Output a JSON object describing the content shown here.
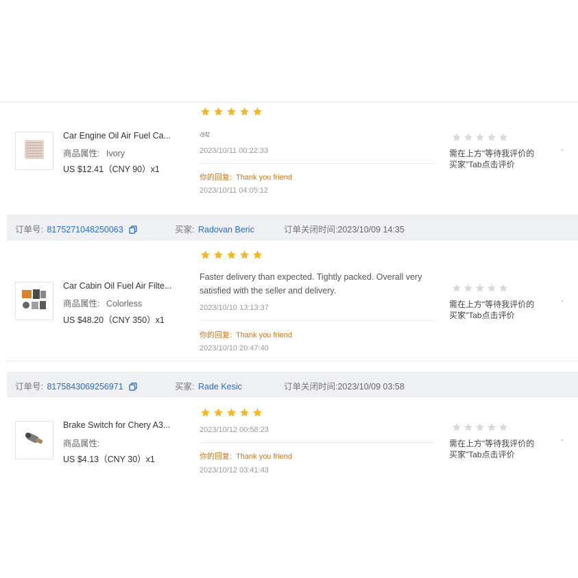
{
  "labels": {
    "order_no": "订单号:",
    "buyer": "买家:",
    "close_time": "订单关闭时间:",
    "your_reply": "你的回复:",
    "wait_line1": "需在上方\"等待我评价的",
    "wait_line2": "买家\"Tab点击评价",
    "more": "·"
  },
  "colors": {
    "star": "#f5b524",
    "star_empty": "#d9d9d9",
    "link": "#2b6cc8",
    "reply": "#c8761e"
  },
  "orders": [
    {
      "header": null,
      "product": {
        "title": "Car Engine Oil Air Fuel Ca...",
        "attr_label": "商品属性:",
        "attr_value": "Ivory",
        "price": "US $12.41（CNY 90）x1",
        "thumb_icon": "air-filter-icon"
      },
      "review": {
        "rating": 5,
        "text": "ওয়",
        "time": "2023/10/11 00:22:33",
        "reply_text": "Thank you friend",
        "reply_time": "2023/10/11 04:05:12"
      },
      "seller_rating": 0
    },
    {
      "header": {
        "order_no": "8175271048250063",
        "buyer": "Radovan Beric",
        "close_time": "2023/10/09 14:35"
      },
      "product": {
        "title": "Car Cabin Oil Fuel Air Filte...",
        "attr_label": "商品属性:",
        "attr_value": "Colorless",
        "price": "US $48.20（CNY 350）x1",
        "thumb_icon": "filter-kit-icon"
      },
      "review": {
        "rating": 5,
        "text": "Faster delivery than expected. Tightly packed. Overall very satisfied with the seller and delivery.",
        "time": "2023/10/10 13:13:37",
        "reply_text": "Thank you friend",
        "reply_time": "2023/10/10 20:47:40"
      },
      "seller_rating": 0
    },
    {
      "header": {
        "order_no": "8175843069256971",
        "buyer": "Rade Kesic",
        "close_time": "2023/10/09 03:58"
      },
      "product": {
        "title": "Brake Switch for Chery A3...",
        "attr_label": "商品属性:",
        "attr_value": "",
        "price": "US $4.13（CNY 30）x1",
        "thumb_icon": "brake-switch-icon"
      },
      "review": {
        "rating": 5,
        "text": "",
        "time": "2023/10/12 00:58:23",
        "reply_text": "Thank you friend",
        "reply_time": "2023/10/12 03:41:43"
      },
      "seller_rating": 0
    }
  ]
}
